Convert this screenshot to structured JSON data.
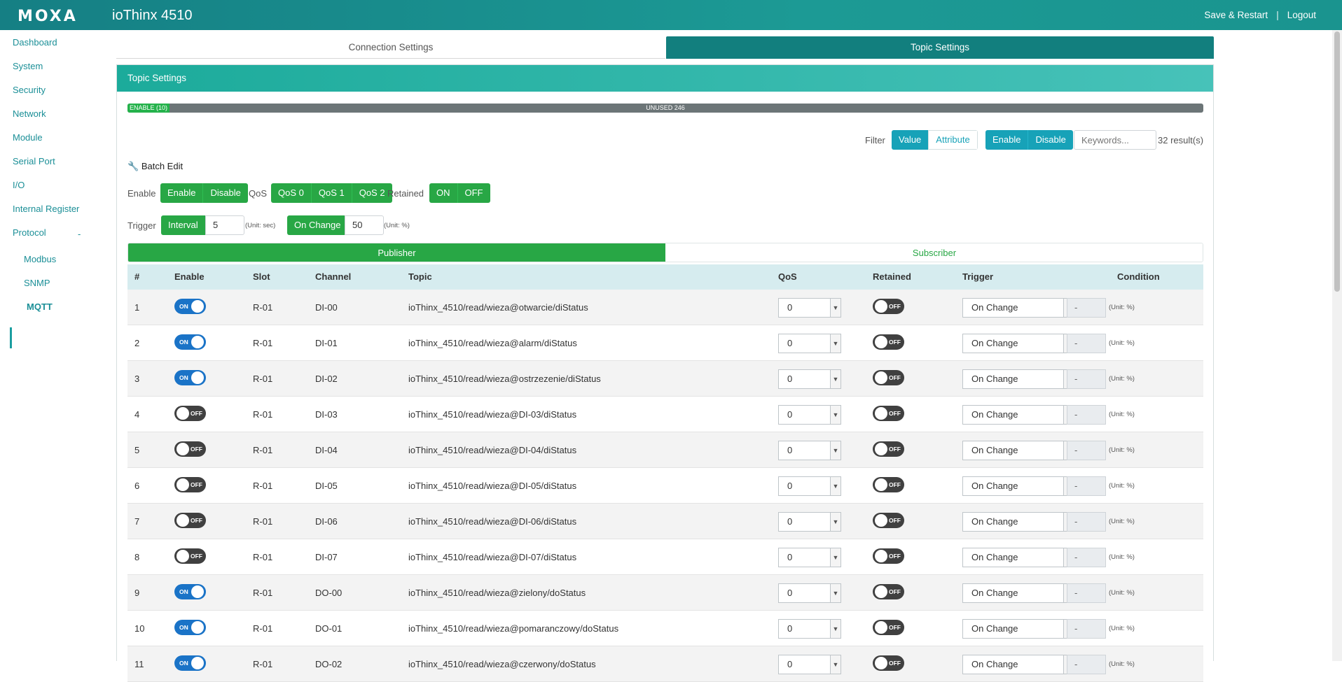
{
  "header": {
    "logo": "MOXA",
    "product": "ioThinx 4510",
    "save_restart": "Save & Restart",
    "separator": "|",
    "logout": "Logout"
  },
  "sidebar": {
    "items": [
      {
        "label": "Dashboard"
      },
      {
        "label": "System"
      },
      {
        "label": "Security"
      },
      {
        "label": "Network"
      },
      {
        "label": "Module"
      },
      {
        "label": "Serial Port"
      },
      {
        "label": "I/O"
      },
      {
        "label": "Internal Register"
      },
      {
        "label": "Protocol"
      }
    ],
    "protocol_toggle": "-",
    "sub_items": [
      {
        "label": "Modbus"
      },
      {
        "label": "SNMP"
      },
      {
        "label": "MQTT"
      }
    ]
  },
  "tabs": {
    "connection": "Connection Settings",
    "topic": "Topic Settings"
  },
  "panel": {
    "title": "Topic Settings",
    "usage": {
      "enable_label": "ENABLE (10)",
      "unused_label": "UNUSED 246",
      "enabled": 10,
      "unused": 246
    }
  },
  "filter": {
    "label": "Filter",
    "value": "Value",
    "attribute": "Attribute",
    "enable": "Enable",
    "disable": "Disable",
    "keywords_placeholder": "Keywords...",
    "results": "32 result(s)"
  },
  "batch": {
    "title": "Batch Edit",
    "enable_label": "Enable",
    "enable_btn": "Enable",
    "disable_btn": "Disable",
    "qos_label": "QoS",
    "qos0": "QoS 0",
    "qos1": "QoS 1",
    "qos2": "QoS 2",
    "retained_label": "Retained",
    "on": "ON",
    "off": "OFF",
    "trigger_label": "Trigger",
    "interval_btn": "Interval",
    "interval_value": "5",
    "interval_unit": "(Unit: sec)",
    "onchange_btn": "On Change",
    "onchange_value": "50",
    "onchange_unit": "(Unit: %)"
  },
  "subtabs": {
    "publisher": "Publisher",
    "subscriber": "Subscriber"
  },
  "table": {
    "columns": [
      "#",
      "Enable",
      "Slot",
      "Channel",
      "Topic",
      "QoS",
      "Retained",
      "Trigger",
      "Condition"
    ],
    "on_text": "ON",
    "off_text": "OFF",
    "condition_unit": "(Unit: %)",
    "rows": [
      {
        "num": "1",
        "enable": true,
        "slot": "R-01",
        "channel": "DI-00",
        "topic": "ioThinx_4510/read/wieza@otwarcie/diStatus",
        "qos": "0",
        "retained": false,
        "trigger": "On Change",
        "condition": "-"
      },
      {
        "num": "2",
        "enable": true,
        "slot": "R-01",
        "channel": "DI-01",
        "topic": "ioThinx_4510/read/wieza@alarm/diStatus",
        "qos": "0",
        "retained": false,
        "trigger": "On Change",
        "condition": "-"
      },
      {
        "num": "3",
        "enable": true,
        "slot": "R-01",
        "channel": "DI-02",
        "topic": "ioThinx_4510/read/wieza@ostrzezenie/diStatus",
        "qos": "0",
        "retained": false,
        "trigger": "On Change",
        "condition": "-"
      },
      {
        "num": "4",
        "enable": false,
        "slot": "R-01",
        "channel": "DI-03",
        "topic": "ioThinx_4510/read/wieza@DI-03/diStatus",
        "qos": "0",
        "retained": false,
        "trigger": "On Change",
        "condition": "-"
      },
      {
        "num": "5",
        "enable": false,
        "slot": "R-01",
        "channel": "DI-04",
        "topic": "ioThinx_4510/read/wieza@DI-04/diStatus",
        "qos": "0",
        "retained": false,
        "trigger": "On Change",
        "condition": "-"
      },
      {
        "num": "6",
        "enable": false,
        "slot": "R-01",
        "channel": "DI-05",
        "topic": "ioThinx_4510/read/wieza@DI-05/diStatus",
        "qos": "0",
        "retained": false,
        "trigger": "On Change",
        "condition": "-"
      },
      {
        "num": "7",
        "enable": false,
        "slot": "R-01",
        "channel": "DI-06",
        "topic": "ioThinx_4510/read/wieza@DI-06/diStatus",
        "qos": "0",
        "retained": false,
        "trigger": "On Change",
        "condition": "-"
      },
      {
        "num": "8",
        "enable": false,
        "slot": "R-01",
        "channel": "DI-07",
        "topic": "ioThinx_4510/read/wieza@DI-07/diStatus",
        "qos": "0",
        "retained": false,
        "trigger": "On Change",
        "condition": "-"
      },
      {
        "num": "9",
        "enable": true,
        "slot": "R-01",
        "channel": "DO-00",
        "topic": "ioThinx_4510/read/wieza@zielony/doStatus",
        "qos": "0",
        "retained": false,
        "trigger": "On Change",
        "condition": "-"
      },
      {
        "num": "10",
        "enable": true,
        "slot": "R-01",
        "channel": "DO-01",
        "topic": "ioThinx_4510/read/wieza@pomaranczowy/doStatus",
        "qos": "0",
        "retained": false,
        "trigger": "On Change",
        "condition": "-"
      },
      {
        "num": "11",
        "enable": true,
        "slot": "R-01",
        "channel": "DO-02",
        "topic": "ioThinx_4510/read/wieza@czerwony/doStatus",
        "qos": "0",
        "retained": false,
        "trigger": "On Change",
        "condition": "-"
      }
    ]
  }
}
